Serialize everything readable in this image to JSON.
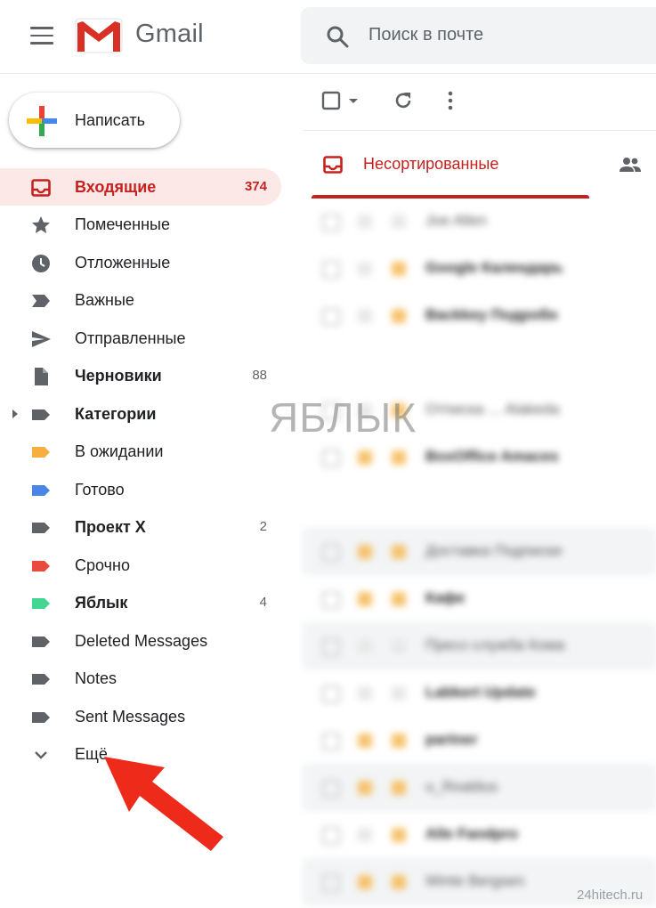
{
  "header": {
    "brand": "Gmail",
    "search_placeholder": "Поиск в почте"
  },
  "sidebar": {
    "compose_label": "Написать",
    "items": [
      {
        "label": "Входящие",
        "count": "374",
        "icon": "inbox-icon",
        "active": true
      },
      {
        "label": "Помеченные",
        "count": "",
        "icon": "star-icon"
      },
      {
        "label": "Отложенные",
        "count": "",
        "icon": "clock-icon"
      },
      {
        "label": "Важные",
        "count": "",
        "icon": "important-icon"
      },
      {
        "label": "Отправленные",
        "count": "",
        "icon": "send-icon"
      },
      {
        "label": "Черновики",
        "count": "88",
        "icon": "draft-icon"
      },
      {
        "label": "Категории",
        "count": "",
        "icon": "label-icon"
      },
      {
        "label": "В ожидании",
        "count": "",
        "icon": "label-icon",
        "color": "#f6ae3e"
      },
      {
        "label": "Готово",
        "count": "",
        "icon": "label-icon",
        "color": "#4a86e8"
      },
      {
        "label": "Проект X",
        "count": "2",
        "icon": "label-icon"
      },
      {
        "label": "Срочно",
        "count": "",
        "icon": "label-icon",
        "color": "#e94b3c"
      },
      {
        "label": "Яблык",
        "count": "4",
        "icon": "label-icon",
        "color": "#43d692"
      },
      {
        "label": "Deleted Messages",
        "count": "",
        "icon": "label-icon"
      },
      {
        "label": "Notes",
        "count": "",
        "icon": "label-icon"
      },
      {
        "label": "Sent Messages",
        "count": "",
        "icon": "label-icon"
      },
      {
        "label": "Ещё",
        "count": "",
        "icon": "chevron-down-icon"
      }
    ]
  },
  "tabs": {
    "active_label": "Несортированные"
  },
  "messages": [
    {
      "sender": "Joe Allen"
    },
    {
      "sender": "Google Календарь"
    },
    {
      "sender": "Backkey Подробн"
    },
    {
      "sender": ""
    },
    {
      "sender": "Отписка ... Alakeda"
    },
    {
      "sender": "BoxOffice Amaces"
    },
    {
      "sender": ""
    },
    {
      "sender": "Доставка Подписки"
    },
    {
      "sender": "Кафе"
    },
    {
      "sender": "Пресс-служба Кома"
    },
    {
      "sender": "Labkert Update"
    },
    {
      "sender": "partner"
    },
    {
      "sender": "u_Roaldus"
    },
    {
      "sender": "Alle Fandpro"
    },
    {
      "sender": "Winte Bergsen"
    }
  ],
  "watermark": "ЯБЛЫК",
  "credit": "24hitech.ru",
  "colors": {
    "accent_red": "#c5221f",
    "active_bg": "#fce8e6",
    "annotation_arrow": "#ee2a1a"
  }
}
